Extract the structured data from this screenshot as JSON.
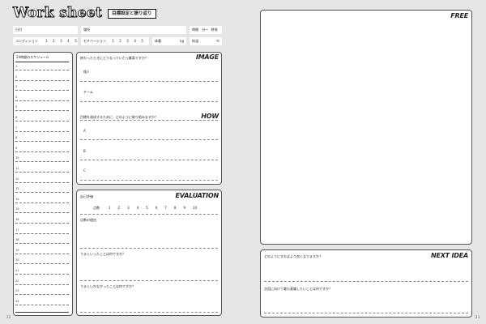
{
  "header": {
    "title": "Work sheet",
    "subtitle": "目標設定と振り返り"
  },
  "info_row1": {
    "date_label": "日付",
    "place_label": "場所",
    "time_label": "時間",
    "time_separator": "分～",
    "time_suffix": "時頃"
  },
  "info_row2": {
    "condition_label": "コンディション",
    "condition_scale": [
      "1",
      "2",
      "3",
      "4",
      "5"
    ],
    "motivation_label": "モチベーション",
    "motivation_scale": [
      "1",
      "2",
      "3",
      "4",
      "5"
    ],
    "weight_label": "体重",
    "weight_unit": "kg",
    "temp_label": "体温",
    "temp_unit": "℃"
  },
  "schedule": {
    "title": "24時間のスケジュール",
    "hours": [
      "1",
      "2",
      "3",
      "4",
      "5",
      "6",
      "7",
      "8",
      "9",
      "10",
      "11",
      "12",
      "13",
      "14",
      "15",
      "16",
      "17",
      "18",
      "19",
      "20",
      "21",
      "22",
      "23",
      "24"
    ]
  },
  "image_section": {
    "tag": "IMAGE",
    "question": "終わったときにどうなっていたら最高ですか？",
    "item1": "個人",
    "item2": "チーム"
  },
  "how_section": {
    "tag": "HOW",
    "question": "目標を達成するために、どのように取り組みますか？",
    "items": [
      "A",
      "B",
      "C"
    ]
  },
  "evaluation": {
    "tag": "EVALUATION",
    "label": "自己評価",
    "score_label": "点数",
    "scale": [
      "1",
      "2",
      "3",
      "4",
      "5",
      "6",
      "7",
      "8",
      "9",
      "10"
    ],
    "reason_label": "点数の理由",
    "good_question": "うまくいったことは何ですか？",
    "bad_question": "うまくいかなかったことは何ですか？"
  },
  "free": {
    "tag": "FREE"
  },
  "next_idea": {
    "tag": "NEXT IDEA",
    "q1": "どのようにすればより良くなりますか？",
    "q2": "次回に向けて最も意識したいことは何ですか？"
  },
  "pages": {
    "left": "22",
    "right": "23"
  }
}
